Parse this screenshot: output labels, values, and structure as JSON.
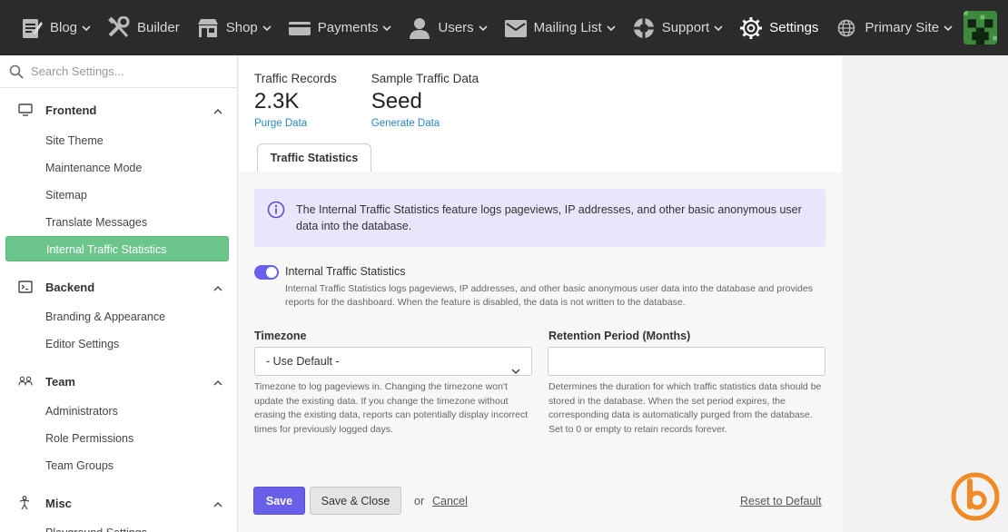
{
  "nav": {
    "items": [
      {
        "label": "Blog",
        "icon": "blog-icon"
      },
      {
        "label": "Builder",
        "icon": "builder-icon"
      },
      {
        "label": "Shop",
        "icon": "shop-icon"
      },
      {
        "label": "Payments",
        "icon": "payments-icon"
      },
      {
        "label": "Users",
        "icon": "users-icon"
      },
      {
        "label": "Mailing List",
        "icon": "mailing-list-icon"
      },
      {
        "label": "Support",
        "icon": "support-icon"
      },
      {
        "label": "Settings",
        "icon": "gear-icon"
      },
      {
        "label": "Primary Site",
        "icon": "globe-icon"
      }
    ]
  },
  "sidebar": {
    "search_placeholder": "Search Settings...",
    "groups": [
      {
        "label": "Frontend",
        "items": [
          "Site Theme",
          "Maintenance Mode",
          "Sitemap",
          "Translate Messages",
          "Internal Traffic Statistics"
        ]
      },
      {
        "label": "Backend",
        "items": [
          "Branding & Appearance",
          "Editor Settings"
        ]
      },
      {
        "label": "Team",
        "items": [
          "Administrators",
          "Role Permissions",
          "Team Groups"
        ]
      },
      {
        "label": "Misc",
        "items": [
          "Playground Settings"
        ]
      }
    ]
  },
  "stats": [
    {
      "label": "Traffic Records",
      "value": "2.3K",
      "link": "Purge Data"
    },
    {
      "label": "Sample Traffic Data",
      "value": "Seed",
      "link": "Generate Data"
    }
  ],
  "tab": "Traffic Statistics",
  "notice": "The Internal Traffic Statistics feature logs pageviews, IP addresses, and other basic anonymous user data into the database.",
  "toggle": {
    "label": "Internal Traffic Statistics",
    "description": "Internal Traffic Statistics logs pageviews, IP addresses, and other basic anonymous user data into the database and provides reports for the dashboard. When the feature is disabled, the data is not written to the database.",
    "on": true
  },
  "timezone": {
    "label": "Timezone",
    "value": "- Use Default -",
    "help": "Timezone to log pageviews in. Changing the timezone won't update the existing data. If you change the timezone without erasing the existing data, reports can potentially display incorrect times for previously logged days."
  },
  "retention": {
    "label": "Retention Period (Months)",
    "value": "",
    "help": "Determines the duration for which traffic statistics data should be stored in the database. When the set period expires, the corresponding data is automatically purged from the database. Set to 0 or empty to retain records forever."
  },
  "actions": {
    "save": "Save",
    "save_close": "Save & Close",
    "or": "or",
    "cancel": "Cancel",
    "reset": "Reset to Default"
  },
  "colors": {
    "topbar": "#2b2b2b",
    "accent": "#6a5fe8",
    "sidebar_active": "#6cc58a",
    "link": "#2b87c8",
    "notice_bg": "#e8e6fb"
  }
}
